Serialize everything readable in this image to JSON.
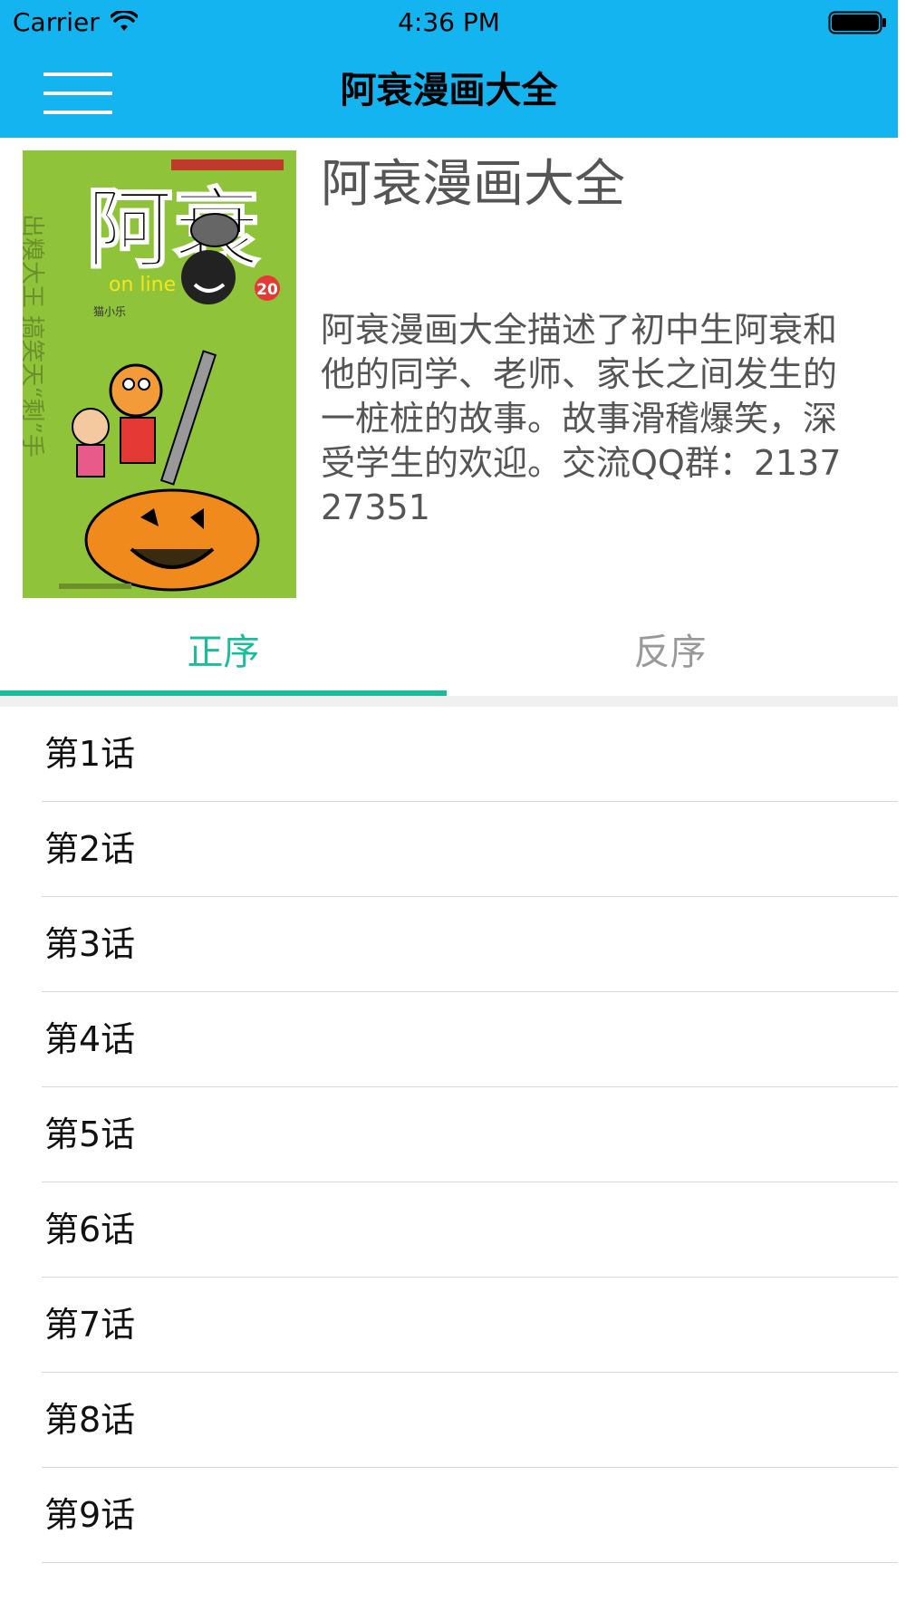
{
  "status_bar": {
    "carrier": "Carrier",
    "time": "4:36 PM"
  },
  "nav": {
    "title": "阿衰漫画大全",
    "menu_icon": "hamburger-menu-icon"
  },
  "comic": {
    "title": "阿衰漫画大全",
    "description": "阿衰漫画大全描述了初中生阿衰和他的同学、老师、家长之间发生的一桩桩的故事。故事滑稽爆笑，深受学生的欢迎。交流QQ群：213727351",
    "cover": {
      "title_text": "阿衰",
      "subtitle_text": "on line",
      "volume": "20",
      "author": "猫小乐",
      "side_text": "出糗大王 搞笑天“剩”手"
    }
  },
  "tabs": [
    {
      "label": "正序",
      "active": true
    },
    {
      "label": "反序",
      "active": false
    }
  ],
  "chapters": [
    {
      "label": "第1话"
    },
    {
      "label": "第2话"
    },
    {
      "label": "第3话"
    },
    {
      "label": "第4话"
    },
    {
      "label": "第5话"
    },
    {
      "label": "第6话"
    },
    {
      "label": "第7话"
    },
    {
      "label": "第8话"
    },
    {
      "label": "第9话"
    }
  ],
  "colors": {
    "nav_background": "#14b4f0",
    "tab_active": "#1abc9c",
    "tab_inactive": "#999999",
    "cover_background": "#8fc43a"
  }
}
